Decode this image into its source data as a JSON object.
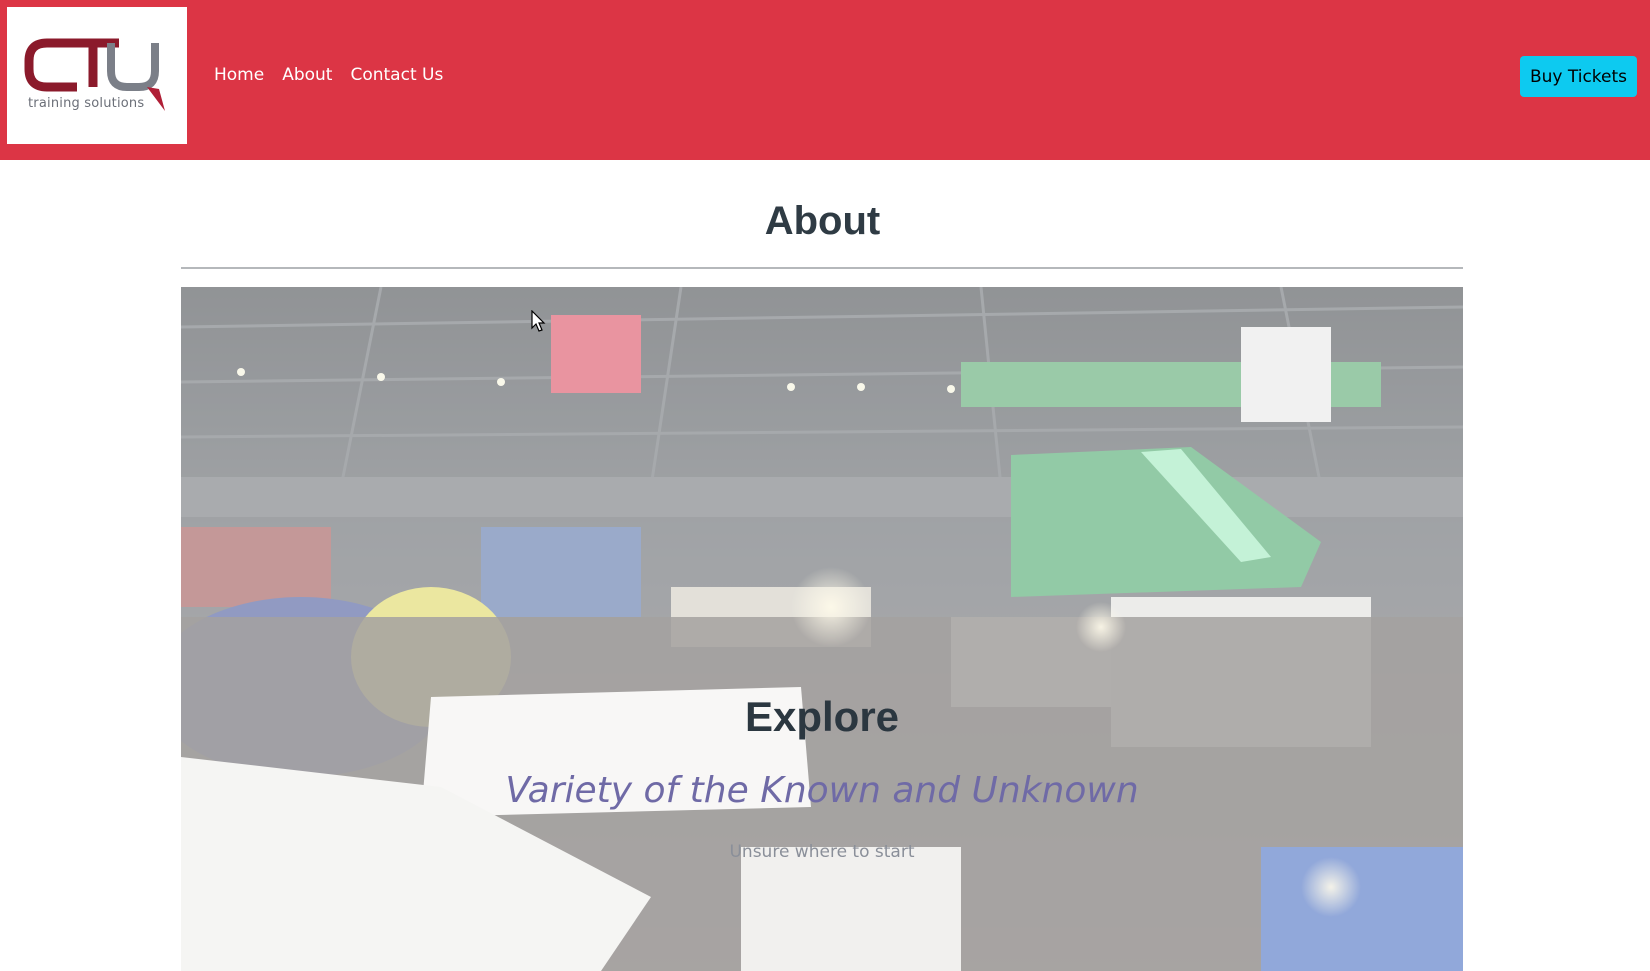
{
  "navbar": {
    "logo": {
      "brand": "CTU",
      "tagline": "training solutions"
    },
    "links": [
      {
        "label": "Home"
      },
      {
        "label": "About"
      },
      {
        "label": "Contact Us"
      }
    ],
    "cta_label": "Buy Tickets"
  },
  "page": {
    "title": "About"
  },
  "hero": {
    "title": "Explore",
    "subtitle": "Variety of the Known and Unknown",
    "tagline": "Unsure where to start",
    "background_image": "expo-crowd-photo"
  },
  "colors": {
    "navbar_bg": "#dc3545",
    "cta_bg": "#0dcaf0",
    "logo_red": "#8b1a2b",
    "logo_gray": "#6b6f78"
  }
}
